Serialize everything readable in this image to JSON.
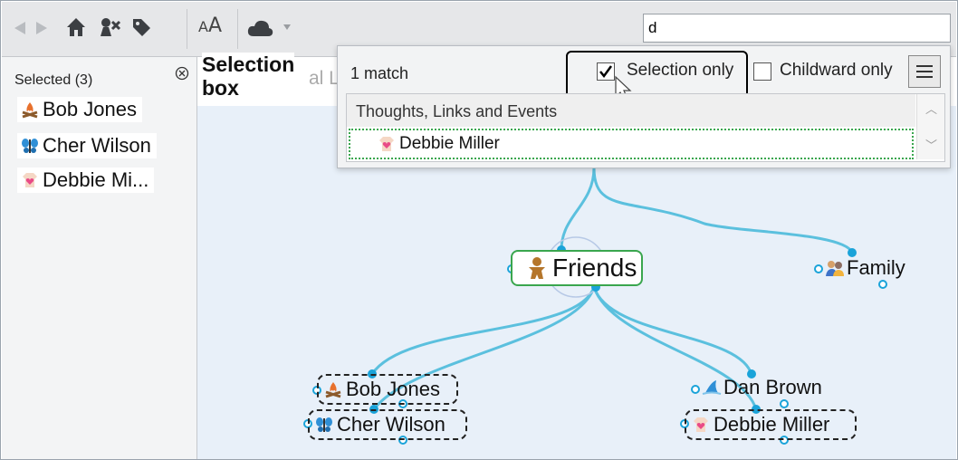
{
  "toolbar": {
    "font_size_label_small": "A",
    "font_size_label_large": "A",
    "search_value": "d"
  },
  "selected_panel": {
    "header": "Selected (3)",
    "items": [
      {
        "label": "Bob Jones",
        "icon": "campfire-icon"
      },
      {
        "label": "Cher Wilson",
        "icon": "butterfly-icon"
      },
      {
        "label": "Debbie Mi...",
        "icon": "heart-shirt-icon"
      }
    ]
  },
  "annotation": {
    "line1": "Selection",
    "line2": "box"
  },
  "background_fragment": "al Li",
  "search_dropdown": {
    "match_count": "1 match",
    "selection_only_label": "Selection only",
    "selection_only_checked": true,
    "childward_only_label": "Childward only",
    "childward_only_checked": false,
    "group_header": "Thoughts, Links and Events",
    "results": [
      {
        "label": "Debbie Miller",
        "icon": "heart-shirt-icon"
      }
    ]
  },
  "map": {
    "central": {
      "label": "Friends",
      "icon": "gingerbread-icon"
    },
    "sibling": {
      "label": "Family",
      "icon": "people-icon"
    },
    "children": [
      {
        "label": "Bob Jones",
        "icon": "campfire-icon",
        "selected": true
      },
      {
        "label": "Cher Wilson",
        "icon": "butterfly-icon",
        "selected": true
      },
      {
        "label": "Dan Brown",
        "icon": "shark-fin-icon",
        "selected": false
      },
      {
        "label": "Debbie Miller",
        "icon": "heart-shirt-icon",
        "selected": true
      }
    ]
  },
  "colors": {
    "link": "#5bc0de",
    "node_border": "#3aa64e",
    "accent": "#1a73e8"
  }
}
